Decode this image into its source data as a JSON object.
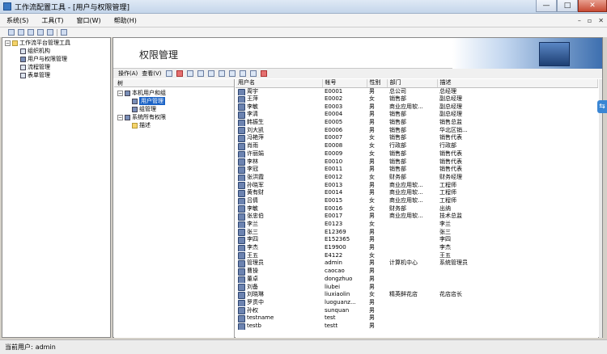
{
  "window": {
    "title": "工作流配置工具 - [用户与权限管理]",
    "min": "—",
    "max": "□",
    "close": "✕"
  },
  "menu": [
    "系统(S)",
    "工具(T)",
    "窗口(W)",
    "帮助(H)"
  ],
  "mdi": {
    "min": "–",
    "restore": "▫",
    "close": "✕"
  },
  "left_tree": {
    "root": "工作流平台管理工具",
    "items": [
      "组织机构",
      "用户与权限管理",
      "流程管理",
      "表单管理"
    ]
  },
  "page": {
    "title": "权限管理",
    "menu_ops": "操作(A)",
    "menu_view": "查看(V)"
  },
  "mid_tree": {
    "header": "树",
    "nodes": [
      "本机用户和组",
      "用户管理",
      "组管理",
      "系统所有权限",
      "描述"
    ]
  },
  "grid": {
    "columns": [
      "用户名",
      "帐号",
      "性别",
      "部门",
      "描述"
    ],
    "rows": [
      [
        "周宇",
        "E0001",
        "男",
        "总公司",
        "总经理"
      ],
      [
        "王萍",
        "E0002",
        "女",
        "销售部",
        "副总经理"
      ],
      [
        "李敏",
        "E0003",
        "男",
        "商业应用软...",
        "副总经理"
      ],
      [
        "李清",
        "E0004",
        "男",
        "销售部",
        "副总经理"
      ],
      [
        "韩振生",
        "E0005",
        "男",
        "销售部",
        "销售总监"
      ],
      [
        "刘大凯",
        "E0006",
        "男",
        "销售部",
        "华北区销..."
      ],
      [
        "冯艳萍",
        "E0007",
        "女",
        "销售部",
        "销售代表"
      ],
      [
        "肖雨",
        "E0008",
        "女",
        "行政部",
        "行政部"
      ],
      [
        "许丽娟",
        "E0009",
        "女",
        "销售部",
        "销售代表"
      ],
      [
        "李林",
        "E0010",
        "男",
        "销售部",
        "销售代表"
      ],
      [
        "李冠",
        "E0011",
        "男",
        "销售部",
        "销售代表"
      ],
      [
        "张洪霞",
        "E0012",
        "女",
        "财务部",
        "财务经理"
      ],
      [
        "孙晓军",
        "E0013",
        "男",
        "商业应用软...",
        "工程师"
      ],
      [
        "黄有财",
        "E0014",
        "男",
        "商业应用软...",
        "工程师"
      ],
      [
        "吕倩",
        "E0015",
        "女",
        "商业应用软...",
        "工程师"
      ],
      [
        "李敏",
        "E0016",
        "女",
        "财务部",
        "出纳"
      ],
      [
        "张忠伯",
        "E0017",
        "男",
        "商业应用软...",
        "技术总监"
      ],
      [
        "李兰",
        "E0123",
        "女",
        "",
        "李兰"
      ],
      [
        "张三",
        "E12369",
        "男",
        "",
        "张三"
      ],
      [
        "李四",
        "E152365",
        "男",
        "",
        "李四"
      ],
      [
        "李杰",
        "E19900",
        "男",
        "",
        "李杰"
      ],
      [
        "王五",
        "E4122",
        "女",
        "",
        "王五"
      ],
      [
        "管理员",
        "admin",
        "男",
        "计算机中心",
        "系统管理员"
      ],
      [
        "曹操",
        "caocao",
        "男",
        "",
        ""
      ],
      [
        "董卓",
        "dongzhuo",
        "男",
        "",
        ""
      ],
      [
        "刘备",
        "liubei",
        "男",
        "",
        ""
      ],
      [
        "刘晓琳",
        "liuxiaolin",
        "女",
        "精英鲜花店",
        "花店店长"
      ],
      [
        "罗贯中",
        "luoguanz...",
        "男",
        "",
        ""
      ],
      [
        "孙权",
        "sunquan",
        "男",
        "",
        ""
      ],
      [
        "testname",
        "test",
        "男",
        "",
        ""
      ],
      [
        "testb",
        "testt",
        "男",
        "",
        ""
      ]
    ]
  },
  "status": {
    "label": "当前用户:",
    "user": "admin"
  },
  "side_tab": "⇆"
}
